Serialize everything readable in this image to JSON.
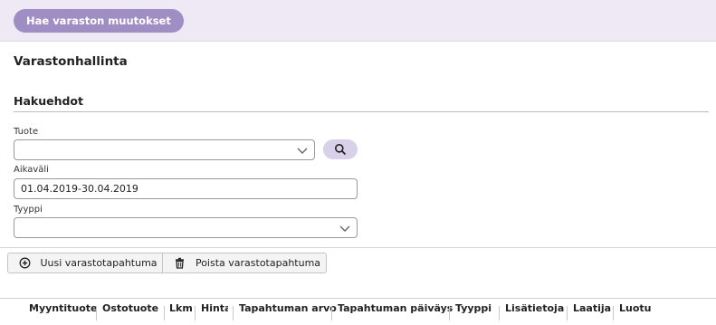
{
  "header": {
    "fetch_button_label": "Hae varaston muutokset"
  },
  "page": {
    "title": "Varastonhallinta"
  },
  "search": {
    "section_title": "Hakuehdot",
    "product": {
      "label": "Tuote",
      "value": ""
    },
    "period": {
      "label": "Aikaväli",
      "value": "01.04.2019-30.04.2019"
    },
    "type": {
      "label": "Tyyppi",
      "value": ""
    }
  },
  "toolbar": {
    "new_label": "Uusi varastotapahtuma",
    "delete_label": "Poista varastotapahtuma"
  },
  "grid": {
    "columns": [
      "Myyntituote",
      "Ostotuote",
      "Lkm",
      "Hinta",
      "Tapahtuman arvo",
      "Tapahtuman päiväys",
      "Tyyppi",
      "Lisätietoja",
      "Laatija",
      "Luotu"
    ]
  },
  "colors": {
    "accent": "#9e8ec4",
    "accent_light": "#d9d0ea",
    "topbar_bg": "#efe9f6"
  },
  "icons": {
    "search": "search-icon",
    "dropdown": "chevron-down-icon",
    "add": "plus-circle-icon",
    "delete": "trash-icon"
  }
}
